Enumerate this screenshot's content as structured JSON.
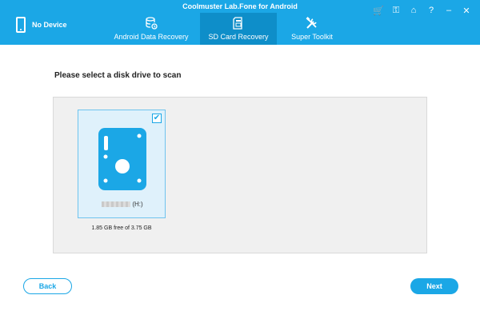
{
  "app": {
    "title": "Coolmuster Lab.Fone for Android"
  },
  "device": {
    "label": "No Device"
  },
  "tabs": [
    {
      "label": "Android Data Recovery",
      "icon": "android-data-recovery-icon",
      "active": false
    },
    {
      "label": "SD Card Recovery",
      "icon": "sd-card-icon",
      "active": true
    },
    {
      "label": "Super Toolkit",
      "icon": "toolkit-icon",
      "active": false
    }
  ],
  "window_controls": [
    "cart-icon",
    "key-icon",
    "home-icon",
    "help-icon",
    "minimize-icon",
    "close-icon"
  ],
  "main": {
    "prompt": "Please select a disk drive to scan",
    "drives": [
      {
        "name_suffix": "(H:)",
        "free_space": "1.85 GB free of 3.75 GB",
        "checked": true,
        "icon": "disk-drive-icon"
      }
    ]
  },
  "buttons": {
    "back": "Back",
    "next": "Next"
  },
  "colors": {
    "accent": "#1ba7e6",
    "active_tab": "#0e8ec9",
    "selected_card": "#dff1fb"
  }
}
